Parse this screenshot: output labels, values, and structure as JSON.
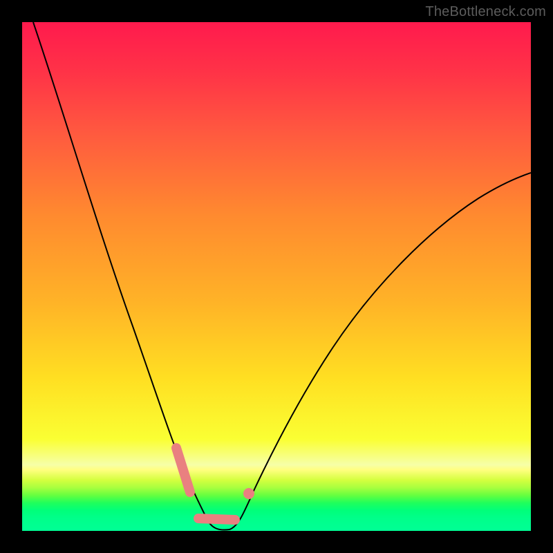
{
  "watermark": "TheBottleneck.com",
  "colors": {
    "background": "#000000",
    "gradient_top": "#ff1a4d",
    "gradient_bottom": "#00ff95",
    "curve": "#000000",
    "marker": "#e98080"
  },
  "chart_data": {
    "type": "line",
    "title": "",
    "xlabel": "",
    "ylabel": "",
    "xlim": [
      0,
      100
    ],
    "ylim": [
      0,
      100
    ],
    "grid": false,
    "legend": false,
    "series": [
      {
        "name": "bottleneck-curve",
        "x": [
          2,
          6,
          10,
          14,
          18,
          22,
          26,
          28,
          30,
          32,
          34,
          36,
          38,
          40,
          42,
          46,
          50,
          56,
          62,
          70,
          80,
          90,
          100
        ],
        "y": [
          100,
          86,
          73,
          61,
          50,
          40,
          30,
          25,
          20,
          14,
          8,
          3,
          0,
          0,
          3,
          10,
          18,
          28,
          37,
          47,
          57,
          64,
          67
        ]
      }
    ],
    "markers": [
      {
        "name": "left-segment",
        "x": [
          30,
          32
        ],
        "y": [
          18,
          9
        ]
      },
      {
        "name": "valley-segment",
        "x": [
          33,
          40
        ],
        "y": [
          2,
          2
        ]
      },
      {
        "name": "right-dot",
        "x": [
          43
        ],
        "y": [
          9
        ]
      }
    ],
    "annotations": []
  }
}
